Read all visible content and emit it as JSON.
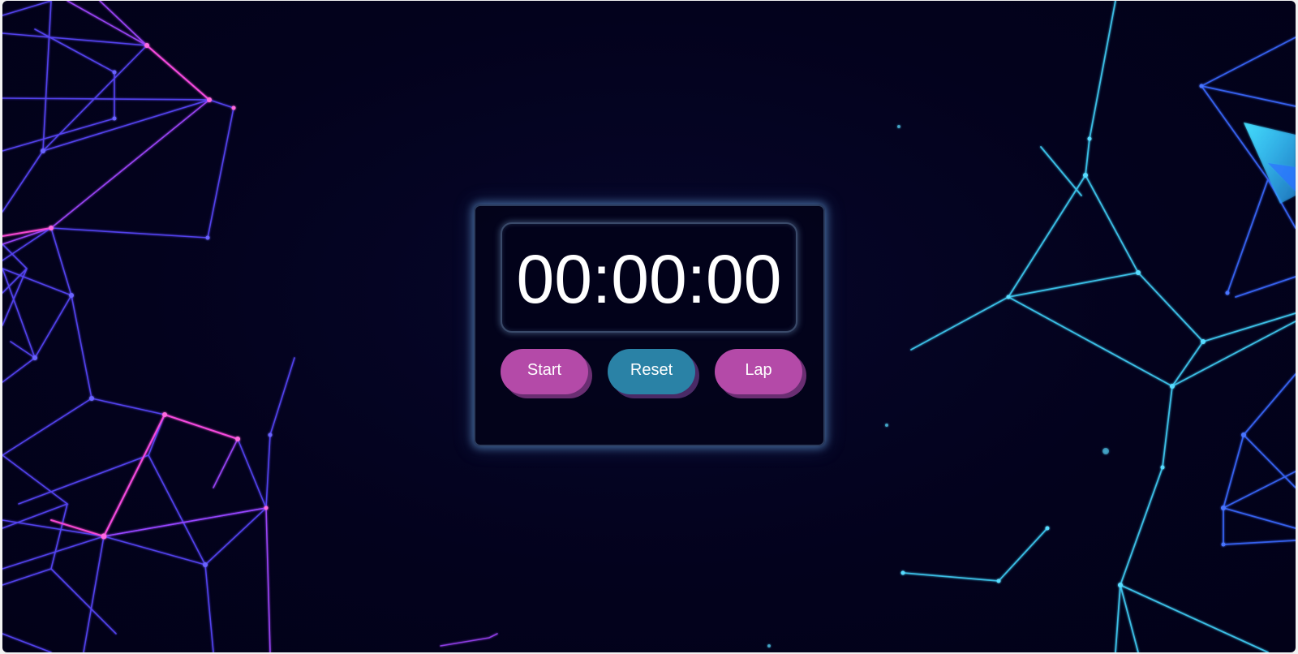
{
  "stopwatch": {
    "time": "00:00:00",
    "buttons": {
      "start": "Start",
      "reset": "Reset",
      "lap": "Lap"
    }
  },
  "colors": {
    "background": "#03021d",
    "start_button": "#b44aa8",
    "reset_button": "#2a82a6",
    "lap_button": "#b44aa8",
    "panel_glow": "#6eaae6",
    "network_left": "#6a4cff",
    "network_right": "#3ec8f0"
  }
}
